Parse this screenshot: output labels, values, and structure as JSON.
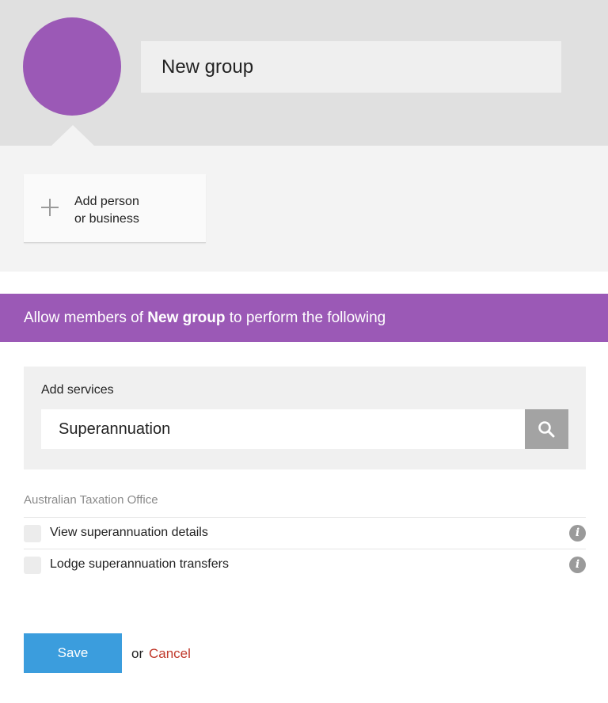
{
  "group": {
    "name": "New group",
    "avatar_color": "#9b59b6"
  },
  "add_member": {
    "icon": "plus-icon",
    "label_line1": "Add person",
    "label_line2": "or business"
  },
  "banner": {
    "prefix": "Allow members of ",
    "group_name": "New group",
    "suffix": " to perform the following",
    "color": "#9b59b6"
  },
  "services": {
    "label": "Add services",
    "search_value": "Superannuation",
    "search_icon": "search-icon"
  },
  "permissions": {
    "agency": "Australian Taxation Office",
    "items": [
      {
        "label": "View superannuation details",
        "checked": false,
        "info_icon": "info-icon"
      },
      {
        "label": "Lodge superannuation transfers",
        "checked": false,
        "info_icon": "info-icon"
      }
    ]
  },
  "actions": {
    "save_label": "Save",
    "or_text": "or",
    "cancel_label": "Cancel",
    "save_color": "#3b9ddd",
    "cancel_color": "#c0392b"
  }
}
